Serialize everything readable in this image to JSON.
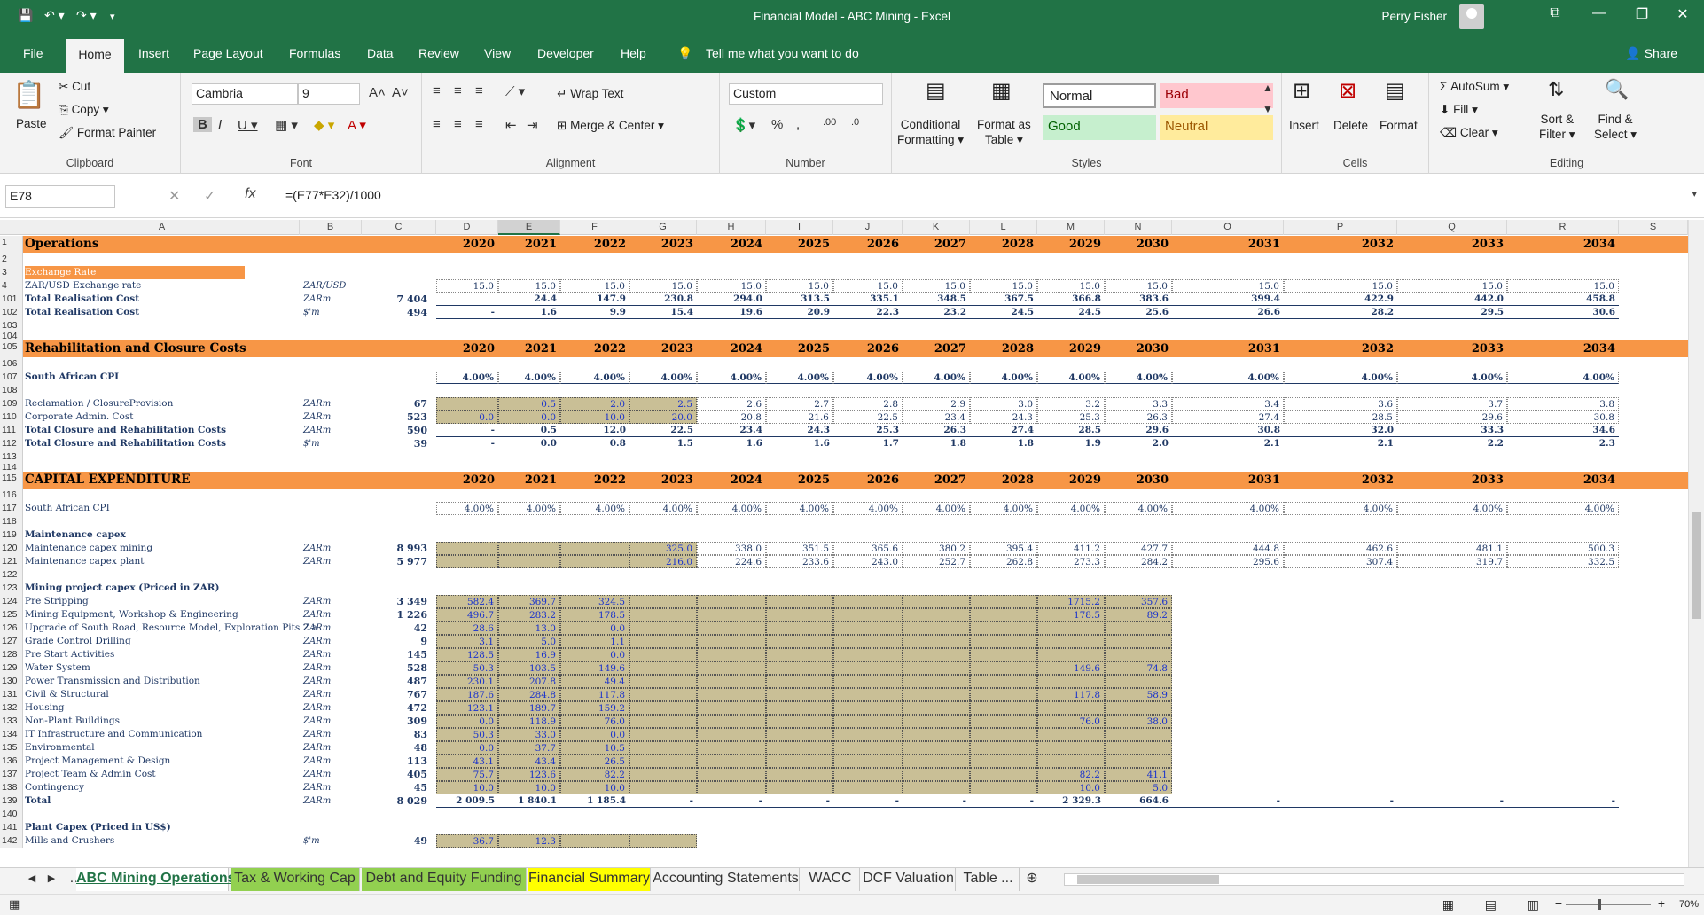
{
  "window": {
    "title": "Financial Model - ABC Mining  -  Excel",
    "user": "Perry Fisher"
  },
  "ribbon_tabs": [
    "File",
    "Home",
    "Insert",
    "Page Layout",
    "Formulas",
    "Data",
    "Review",
    "View",
    "Developer",
    "Help"
  ],
  "tell_me": "Tell me what you want to do",
  "share": "Share",
  "clipboard": {
    "paste": "Paste",
    "cut": "Cut",
    "copy": "Copy",
    "painter": "Format Painter",
    "label": "Clipboard"
  },
  "font": {
    "name": "Cambria",
    "size": "9",
    "label": "Font"
  },
  "alignment": {
    "wrap": "Wrap Text",
    "merge": "Merge & Center",
    "label": "Alignment"
  },
  "number": {
    "format": "Custom",
    "label": "Number"
  },
  "styles": {
    "conditional": "Conditional",
    "formatting": "Formatting",
    "format_as": "Format as",
    "table": "Table",
    "normal": "Normal",
    "bad": "Bad",
    "good": "Good",
    "neutral": "Neutral",
    "label": "Styles"
  },
  "cells": {
    "insert": "Insert",
    "delete": "Delete",
    "format": "Format",
    "label": "Cells"
  },
  "editing": {
    "autosum": "AutoSum",
    "fill": "Fill",
    "clear": "Clear",
    "sort": "Sort &",
    "filter": "Filter",
    "find": "Find &",
    "select": "Select",
    "label": "Editing"
  },
  "formula_bar": {
    "cell": "E78",
    "formula": "=(E77*E32)/1000"
  },
  "columns": [
    "A",
    "B",
    "C",
    "D",
    "E",
    "F",
    "G",
    "H",
    "I",
    "J",
    "K",
    "L",
    "M",
    "N",
    "O",
    "P",
    "Q",
    "R",
    "S"
  ],
  "years": [
    "2020",
    "2021",
    "2022",
    "2023",
    "2024",
    "2025",
    "2026",
    "2027",
    "2028",
    "2029",
    "2030",
    "2031",
    "2032",
    "2033",
    "2034"
  ],
  "rows": [
    {
      "n": "1",
      "label": "Operations",
      "type": "sec"
    },
    {
      "n": "2"
    },
    {
      "n": "3",
      "label": "Exchange Rate",
      "type": "subhdr"
    },
    {
      "n": "4",
      "label": "ZAR/USD Exchange rate",
      "unit": "ZAR/USD",
      "vals": [
        "15.0",
        "15.0",
        "15.0",
        "15.0",
        "15.0",
        "15.0",
        "15.0",
        "15.0",
        "15.0",
        "15.0",
        "15.0",
        "15.0",
        "15.0",
        "15.0",
        "15.0"
      ],
      "style": "inp"
    },
    {
      "n": "101",
      "label": "Total Realisation Cost",
      "unit": "ZARm",
      "total": "7 404",
      "vals": [
        "",
        "24.4",
        "147.9",
        "230.8",
        "294.0",
        "313.5",
        "335.1",
        "348.5",
        "367.5",
        "366.8",
        "383.6",
        "399.4",
        "422.9",
        "442.0",
        "458.8"
      ],
      "type": "bold"
    },
    {
      "n": "102",
      "label": "Total Realisation Cost",
      "unit": "$'m",
      "total": "494",
      "vals": [
        "-",
        "1.6",
        "9.9",
        "15.4",
        "19.6",
        "20.9",
        "22.3",
        "23.2",
        "24.5",
        "24.5",
        "25.6",
        "26.6",
        "28.2",
        "29.5",
        "30.6"
      ],
      "type": "bold"
    },
    {
      "n": "103"
    },
    {
      "n": "104"
    },
    {
      "n": "105",
      "label": "Rehabilitation and Closure Costs",
      "type": "sec"
    },
    {
      "n": "106"
    },
    {
      "n": "107",
      "label": "South African CPI",
      "vals": [
        "4.00%",
        "4.00%",
        "4.00%",
        "4.00%",
        "4.00%",
        "4.00%",
        "4.00%",
        "4.00%",
        "4.00%",
        "4.00%",
        "4.00%",
        "4.00%",
        "4.00%",
        "4.00%",
        "4.00%"
      ],
      "style": "inp",
      "type": "bold"
    },
    {
      "n": "108"
    },
    {
      "n": "109",
      "label": "Reclamation / ClosureProvision",
      "unit": "ZARm",
      "total": "67",
      "vals": [
        "",
        "0.5",
        "2.0",
        "2.5",
        "2.6",
        "2.7",
        "2.8",
        "2.9",
        "3.0",
        "3.2",
        "3.3",
        "3.4",
        "3.6",
        "3.7",
        "3.8"
      ],
      "beige": 4
    },
    {
      "n": "110",
      "label": "Corporate Admin. Cost",
      "unit": "ZARm",
      "total": "523",
      "vals": [
        "0.0",
        "0.0",
        "10.0",
        "20.0",
        "20.8",
        "21.6",
        "22.5",
        "23.4",
        "24.3",
        "25.3",
        "26.3",
        "27.4",
        "28.5",
        "29.6",
        "30.8"
      ],
      "beige": 4
    },
    {
      "n": "111",
      "label": "Total Closure and Rehabilitation Costs",
      "unit": "ZARm",
      "total": "590",
      "vals": [
        "-",
        "0.5",
        "12.0",
        "22.5",
        "23.4",
        "24.3",
        "25.3",
        "26.3",
        "27.4",
        "28.5",
        "29.6",
        "30.8",
        "32.0",
        "33.3",
        "34.6"
      ],
      "type": "bold"
    },
    {
      "n": "112",
      "label": "Total Closure and Rehabilitation Costs",
      "unit": "$'m",
      "total": "39",
      "vals": [
        "-",
        "0.0",
        "0.8",
        "1.5",
        "1.6",
        "1.6",
        "1.7",
        "1.8",
        "1.8",
        "1.9",
        "2.0",
        "2.1",
        "2.1",
        "2.2",
        "2.3"
      ],
      "type": "bold"
    },
    {
      "n": "113"
    },
    {
      "n": "114"
    },
    {
      "n": "115",
      "label": "CAPITAL EXPENDITURE",
      "type": "sec"
    },
    {
      "n": "116"
    },
    {
      "n": "117",
      "label": "South African CPI",
      "vals": [
        "4.00%",
        "4.00%",
        "4.00%",
        "4.00%",
        "4.00%",
        "4.00%",
        "4.00%",
        "4.00%",
        "4.00%",
        "4.00%",
        "4.00%",
        "4.00%",
        "4.00%",
        "4.00%",
        "4.00%"
      ],
      "style": "inp"
    },
    {
      "n": "118"
    },
    {
      "n": "119",
      "label": "Maintenance capex",
      "type": "bold"
    },
    {
      "n": "120",
      "label": "Maintenance capex mining",
      "unit": "ZARm",
      "total": "8 993",
      "vals": [
        "",
        "",
        "",
        "325.0",
        "338.0",
        "351.5",
        "365.6",
        "380.2",
        "395.4",
        "411.2",
        "427.7",
        "444.8",
        "462.6",
        "481.1",
        "500.3"
      ],
      "beige": 4
    },
    {
      "n": "121",
      "label": "Maintenance capex plant",
      "unit": "ZARm",
      "total": "5 977",
      "vals": [
        "",
        "",
        "",
        "216.0",
        "224.6",
        "233.6",
        "243.0",
        "252.7",
        "262.8",
        "273.3",
        "284.2",
        "295.6",
        "307.4",
        "319.7",
        "332.5"
      ],
      "beige": 4
    },
    {
      "n": "122"
    },
    {
      "n": "123",
      "label": "Mining project capex (Priced in ZAR)",
      "type": "bold"
    },
    {
      "n": "124",
      "label": "Pre Stripping",
      "unit": "ZARm",
      "total": "3 349",
      "vals": [
        "582.4",
        "369.7",
        "324.5",
        "",
        "",
        "",
        "",
        "",
        "",
        "1715.2",
        "357.6",
        "",
        "",
        "",
        ""
      ],
      "beige": 11
    },
    {
      "n": "125",
      "label": "Mining Equipment, Workshop & Engineering",
      "unit": "ZARm",
      "total": "1 226",
      "vals": [
        "496.7",
        "283.2",
        "178.5",
        "",
        "",
        "",
        "",
        "",
        "",
        "178.5",
        "89.2",
        "",
        "",
        "",
        ""
      ],
      "beige": 11
    },
    {
      "n": "126",
      "label": "Upgrade of South Road, Resource Model, Exploration Pits 2 a",
      "unit": "ZARm",
      "total": "42",
      "vals": [
        "28.6",
        "13.0",
        "0.0",
        "",
        "",
        "",
        "",
        "",
        "",
        "",
        "",
        "",
        "",
        "",
        ""
      ],
      "beige": 11
    },
    {
      "n": "127",
      "label": "Grade Control Drilling",
      "unit": "ZARm",
      "total": "9",
      "vals": [
        "3.1",
        "5.0",
        "1.1",
        "",
        "",
        "",
        "",
        "",
        "",
        "",
        "",
        "",
        "",
        "",
        ""
      ],
      "beige": 11
    },
    {
      "n": "128",
      "label": "Pre Start Activities",
      "unit": "ZARm",
      "total": "145",
      "vals": [
        "128.5",
        "16.9",
        "0.0",
        "",
        "",
        "",
        "",
        "",
        "",
        "",
        "",
        "",
        "",
        "",
        ""
      ],
      "beige": 11
    },
    {
      "n": "129",
      "label": "Water System",
      "unit": "ZARm",
      "total": "528",
      "vals": [
        "50.3",
        "103.5",
        "149.6",
        "",
        "",
        "",
        "",
        "",
        "",
        "149.6",
        "74.8",
        "",
        "",
        "",
        ""
      ],
      "beige": 11
    },
    {
      "n": "130",
      "label": "Power Transmission and Distribution",
      "unit": "ZARm",
      "total": "487",
      "vals": [
        "230.1",
        "207.8",
        "49.4",
        "",
        "",
        "",
        "",
        "",
        "",
        "",
        "",
        "",
        "",
        "",
        ""
      ],
      "beige": 11
    },
    {
      "n": "131",
      "label": "Civil & Structural",
      "unit": "ZARm",
      "total": "767",
      "vals": [
        "187.6",
        "284.8",
        "117.8",
        "",
        "",
        "",
        "",
        "",
        "",
        "117.8",
        "58.9",
        "",
        "",
        "",
        ""
      ],
      "beige": 11
    },
    {
      "n": "132",
      "label": "Housing",
      "unit": "ZARm",
      "total": "472",
      "vals": [
        "123.1",
        "189.7",
        "159.2",
        "",
        "",
        "",
        "",
        "",
        "",
        "",
        "",
        "",
        "",
        "",
        ""
      ],
      "beige": 11
    },
    {
      "n": "133",
      "label": "Non-Plant Buildings",
      "unit": "ZARm",
      "total": "309",
      "vals": [
        "0.0",
        "118.9",
        "76.0",
        "",
        "",
        "",
        "",
        "",
        "",
        "76.0",
        "38.0",
        "",
        "",
        "",
        ""
      ],
      "beige": 11
    },
    {
      "n": "134",
      "label": "IT Infrastructure and Communication",
      "unit": "ZARm",
      "total": "83",
      "vals": [
        "50.3",
        "33.0",
        "0.0",
        "",
        "",
        "",
        "",
        "",
        "",
        "",
        "",
        "",
        "",
        "",
        ""
      ],
      "beige": 11
    },
    {
      "n": "135",
      "label": "Environmental",
      "unit": "ZARm",
      "total": "48",
      "vals": [
        "0.0",
        "37.7",
        "10.5",
        "",
        "",
        "",
        "",
        "",
        "",
        "",
        "",
        "",
        "",
        "",
        ""
      ],
      "beige": 11
    },
    {
      "n": "136",
      "label": "Project Management & Design",
      "unit": "ZARm",
      "total": "113",
      "vals": [
        "43.1",
        "43.4",
        "26.5",
        "",
        "",
        "",
        "",
        "",
        "",
        "",
        "",
        "",
        "",
        "",
        ""
      ],
      "beige": 11
    },
    {
      "n": "137",
      "label": "Project Team & Admin Cost",
      "unit": "ZARm",
      "total": "405",
      "vals": [
        "75.7",
        "123.6",
        "82.2",
        "",
        "",
        "",
        "",
        "",
        "",
        "82.2",
        "41.1",
        "",
        "",
        "",
        ""
      ],
      "beige": 11
    },
    {
      "n": "138",
      "label": "Contingency",
      "unit": "ZARm",
      "total": "45",
      "vals": [
        "10.0",
        "10.0",
        "10.0",
        "",
        "",
        "",
        "",
        "",
        "",
        "10.0",
        "5.0",
        "",
        "",
        "",
        ""
      ],
      "beige": 11
    },
    {
      "n": "139",
      "label": "Total",
      "unit": "ZARm",
      "total": "8 029",
      "vals": [
        "2 009.5",
        "1 840.1",
        "1 185.4",
        "-",
        "-",
        "-",
        "-",
        "-",
        "-",
        "2 329.3",
        "664.6",
        "-",
        "-",
        "-",
        "-"
      ],
      "type": "bold"
    },
    {
      "n": "140"
    },
    {
      "n": "141",
      "label": "Plant Capex (Priced in US$)",
      "type": "bold"
    },
    {
      "n": "142",
      "label": "Mills and Crushers",
      "unit": "$'m",
      "total": "49",
      "vals": [
        "36.7",
        "12.3",
        "",
        "",
        "",
        "",
        "",
        "",
        "",
        "",
        "",
        "",
        "",
        "",
        ""
      ],
      "beige": 4
    }
  ],
  "sheet_tabs": [
    "ABC Mining Operations",
    "Tax & Working Cap",
    "Debt and Equity Funding",
    "Financial Summary",
    "Accounting Statements",
    "WACC",
    "DCF Valuation",
    "Table ..."
  ],
  "zoom": "70%"
}
